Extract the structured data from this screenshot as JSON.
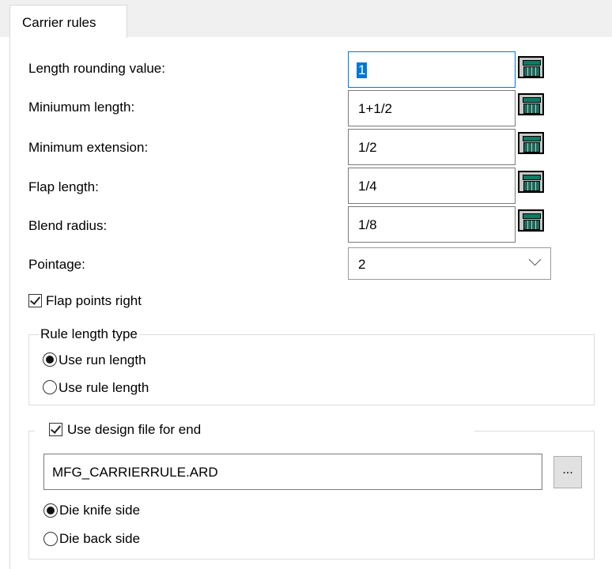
{
  "tab": {
    "label": "Carrier rules"
  },
  "fields": {
    "length_rounding": {
      "label": "Length rounding value:",
      "value": "1"
    },
    "minimum_length": {
      "label": "Miniumum length:",
      "value": "1+1/2"
    },
    "minimum_extension": {
      "label": "Minimum extension:",
      "value": "1/2"
    },
    "flap_length": {
      "label": "Flap length:",
      "value": "1/4"
    },
    "blend_radius": {
      "label": "Blend radius:",
      "value": "1/8"
    },
    "pointage": {
      "label": "Pointage:",
      "value": "2"
    }
  },
  "flap_points_right": {
    "label": "Flap points right",
    "checked": true
  },
  "rule_length_type": {
    "legend": "Rule length type",
    "options": [
      {
        "label": "Use run length",
        "selected": true
      },
      {
        "label": "Use rule length",
        "selected": false
      }
    ]
  },
  "design_file": {
    "checkbox_label": "Use design file for end",
    "checked": true,
    "filename": "MFG_CARRIERRULE.ARD",
    "browse_label": "...",
    "options": [
      {
        "label": "Die knife side",
        "selected": true
      },
      {
        "label": "Die back side",
        "selected": false
      }
    ]
  },
  "colors": {
    "accent": "#0078d7",
    "calculator": "#1a6b5b"
  },
  "icons": {
    "calculator": "calculator-icon",
    "dropdown": "chevron-down-icon"
  }
}
